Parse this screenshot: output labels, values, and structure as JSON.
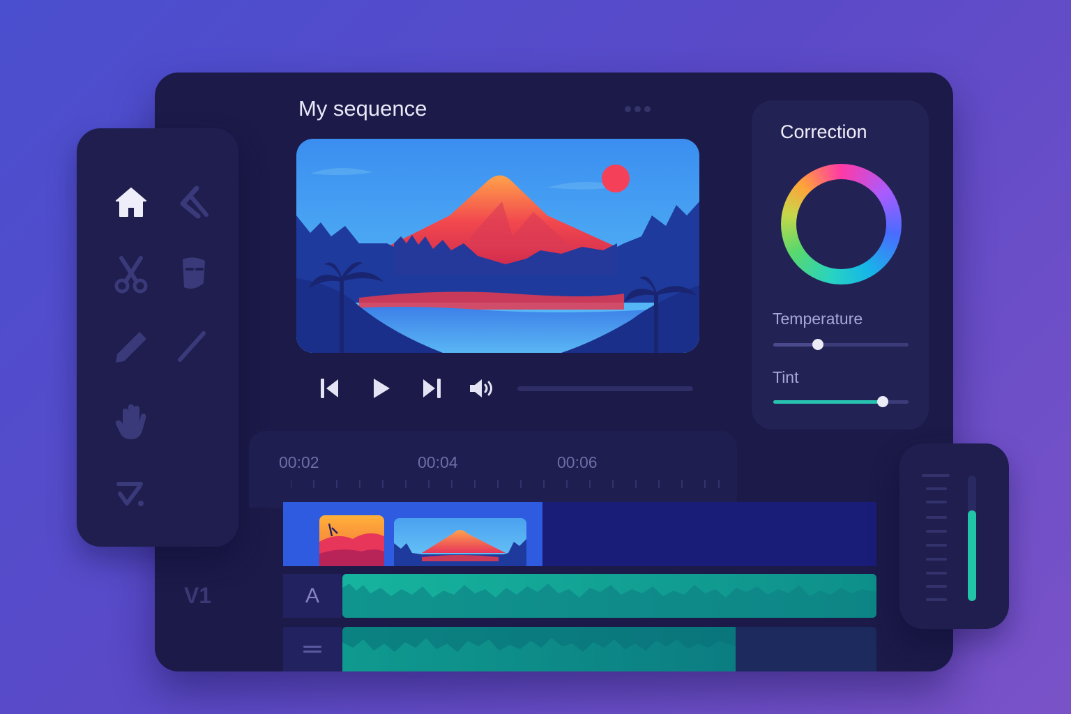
{
  "sequence": {
    "title": "My sequence"
  },
  "sidebar": {
    "tools": [
      {
        "name": "home",
        "icon": "home-icon"
      },
      {
        "name": "select",
        "icon": "arrow-select-icon"
      },
      {
        "name": "cut",
        "icon": "scissors-icon"
      },
      {
        "name": "mask",
        "icon": "mask-icon"
      },
      {
        "name": "pencil",
        "icon": "pencil-icon"
      },
      {
        "name": "pen",
        "icon": "pen-icon"
      },
      {
        "name": "hand",
        "icon": "hand-icon"
      },
      {
        "name": "check",
        "icon": "checkmark-icon"
      }
    ]
  },
  "transport": {
    "buttons": [
      "skip-back-icon",
      "play-icon",
      "skip-forward-icon",
      "volume-icon"
    ],
    "progress": 0
  },
  "correction": {
    "title": "Correction",
    "temperature": {
      "label": "Temperature",
      "value": 0.33
    },
    "tint": {
      "label": "Tint",
      "value": 0.81
    }
  },
  "timeline": {
    "timecodes": [
      "00:02",
      "00:04",
      "00:06"
    ],
    "tracks": {
      "video_label": "V1",
      "audio_label": "A",
      "menu_icon": "drag-handle-icon"
    }
  },
  "colors": {
    "accent": "#2f5be0",
    "audio": "#16b49e",
    "background": "#1b1a48"
  }
}
